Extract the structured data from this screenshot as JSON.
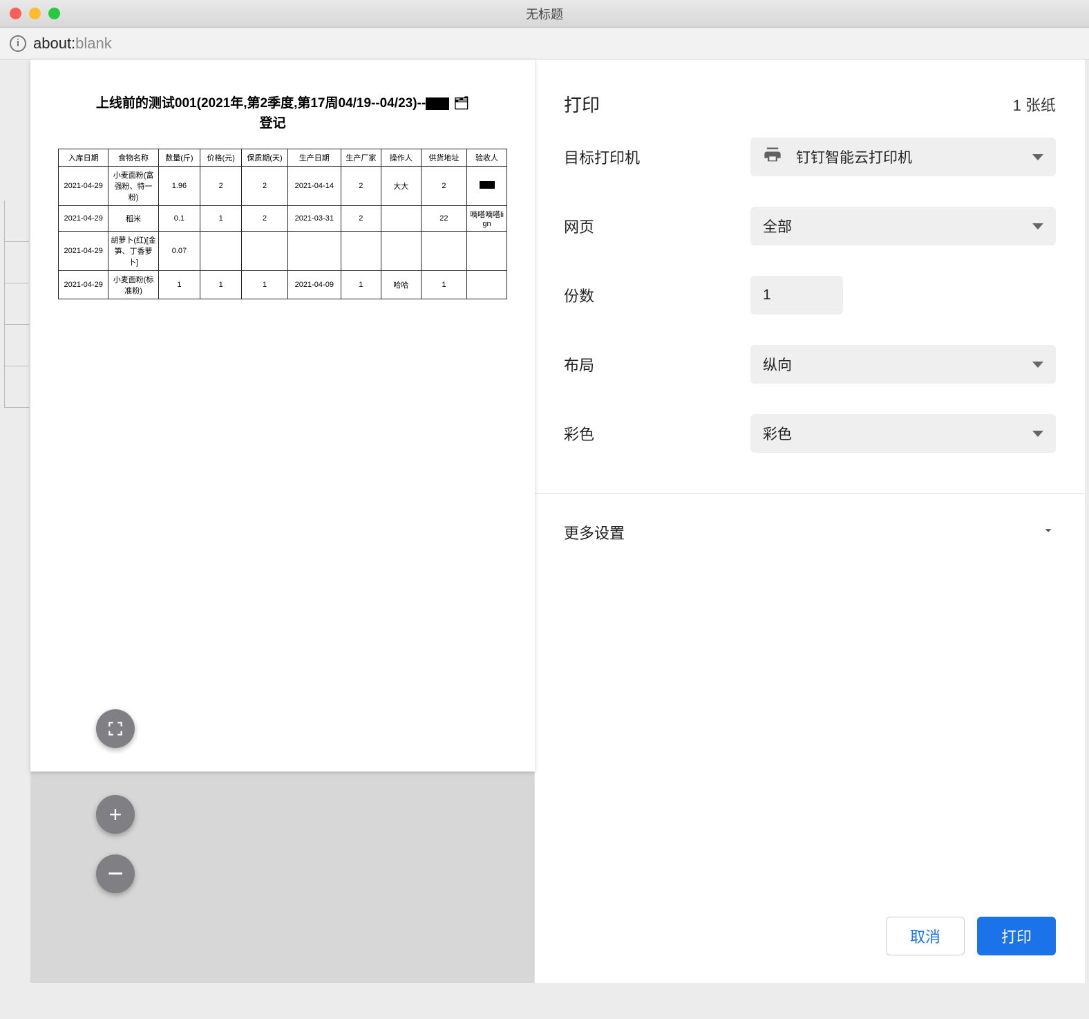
{
  "window": {
    "title": "无标题"
  },
  "address": {
    "about": "about:",
    "blank": "blank"
  },
  "preview": {
    "doc_title": "上线前的测试001(2021年,第2季度,第17周04/19--04/23)--",
    "doc_title_suffix": "登记",
    "columns": [
      "入库日期",
      "食物名称",
      "数量(斤)",
      "价格(元)",
      "保质期(天)",
      "生产日期",
      "生产厂家",
      "操作人",
      "供货地址",
      "验收人"
    ],
    "rows": [
      [
        "2021-04-29",
        "小麦面粉(富强粉、特一粉)",
        "1.96",
        "2",
        "2",
        "2021-04-14",
        "2",
        "大大",
        "2",
        "__SIG__"
      ],
      [
        "2021-04-29",
        "稻米",
        "0.1",
        "1",
        "2",
        "2021-03-31",
        "2",
        "",
        "22",
        "嘀嗒嘀嗒lign"
      ],
      [
        "2021-04-29",
        "胡萝卜(红)[金笋、丁香萝卜]",
        "0.07",
        "",
        "",
        "",
        "",
        "",
        "",
        ""
      ],
      [
        "2021-04-29",
        "小麦面粉(标准粉)",
        "1",
        "1",
        "1",
        "2021-04-09",
        "1",
        "哈哈",
        "1",
        ""
      ]
    ]
  },
  "panel": {
    "title": "打印",
    "sheets": "1 张纸",
    "labels": {
      "printer": "目标打印机",
      "pages": "网页",
      "copies": "份数",
      "layout": "布局",
      "color": "彩色",
      "more": "更多设置"
    },
    "values": {
      "printer": "钉钉智能云打印机",
      "pages": "全部",
      "copies": "1",
      "layout": "纵向",
      "color": "彩色"
    },
    "buttons": {
      "cancel": "取消",
      "print": "打印"
    }
  }
}
